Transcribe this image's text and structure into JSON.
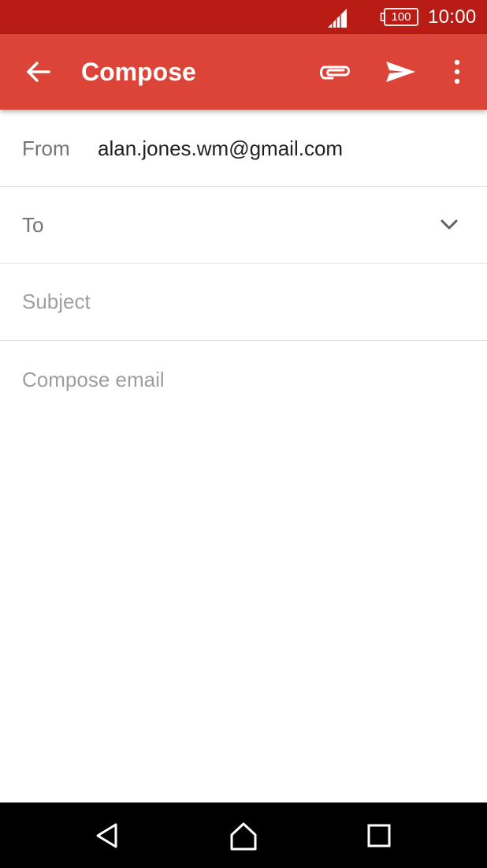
{
  "status_bar": {
    "battery": "100",
    "time": "10:00",
    "icons": [
      "signal-icon",
      "battery-icon"
    ]
  },
  "app_bar": {
    "title": "Compose",
    "icons": [
      "back-arrow-icon",
      "paperclip-icon",
      "send-icon",
      "more-vert-icon"
    ]
  },
  "form": {
    "from_label": "From",
    "from_value": "alan.jones.wm@gmail.com",
    "to_placeholder": "To",
    "to_value": "",
    "subject_placeholder": "Subject",
    "subject_value": "",
    "body_placeholder": "Compose email",
    "body_value": ""
  },
  "nav_bar": {
    "icons": [
      "nav-back-icon",
      "nav-home-icon",
      "nav-recents-icon"
    ]
  },
  "colors": {
    "status_bar": "#b81c14",
    "app_bar": "#db4437",
    "nav_bar": "#000000"
  }
}
